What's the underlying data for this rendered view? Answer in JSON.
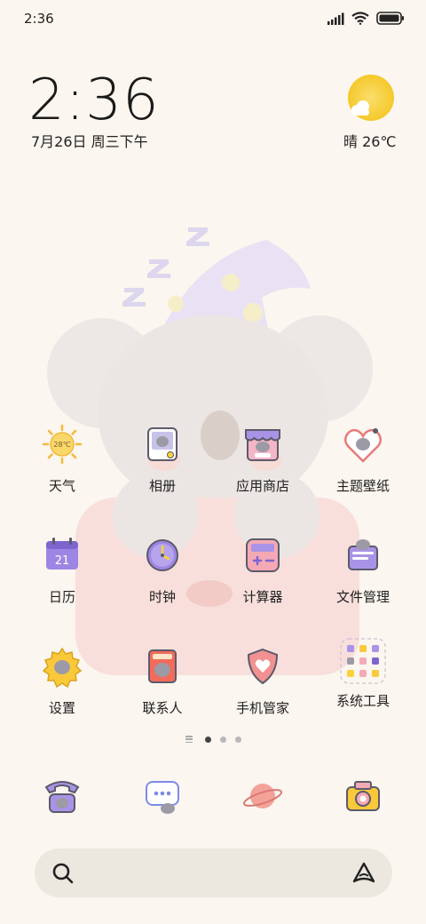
{
  "status_bar": {
    "time": "2:36",
    "icons": [
      "signal-icon",
      "wifi-icon",
      "battery-icon"
    ]
  },
  "clock_widget": {
    "time": "2:36",
    "date": "7月26日 周三下午"
  },
  "weather_widget": {
    "text": "晴 26℃",
    "icon": "sun-cloud-icon",
    "badge_temp": "28℃"
  },
  "home_grid": {
    "row1": [
      {
        "label": "天气",
        "icon": "weather-sun-icon"
      },
      {
        "label": "相册",
        "icon": "gallery-icon"
      },
      {
        "label": "应用商店",
        "icon": "app-store-icon"
      },
      {
        "label": "主题壁纸",
        "icon": "themes-icon"
      }
    ],
    "row2": [
      {
        "label": "日历",
        "icon": "calendar-icon",
        "day": "21"
      },
      {
        "label": "时钟",
        "icon": "clock-icon"
      },
      {
        "label": "计算器",
        "icon": "calculator-icon"
      },
      {
        "label": "文件管理",
        "icon": "file-manager-icon"
      }
    ],
    "row3": [
      {
        "label": "设置",
        "icon": "settings-icon"
      },
      {
        "label": "联系人",
        "icon": "contacts-icon"
      },
      {
        "label": "手机管家",
        "icon": "security-icon"
      },
      {
        "label": "系统工具",
        "icon": "system-tools-folder-icon"
      }
    ]
  },
  "dock": [
    {
      "icon": "phone-icon"
    },
    {
      "icon": "messages-icon"
    },
    {
      "icon": "browser-planet-icon"
    },
    {
      "icon": "camera-icon"
    }
  ],
  "pager": {
    "pages": 3,
    "active": 1
  },
  "search_bar": {
    "left_icon": "search-icon",
    "right_icon": "assistant-icon"
  },
  "colors": {
    "background": "#fbf6ef",
    "accent_purple": "#a993e6",
    "accent_yellow": "#f9d33a",
    "accent_pink": "#f3a7a7"
  }
}
